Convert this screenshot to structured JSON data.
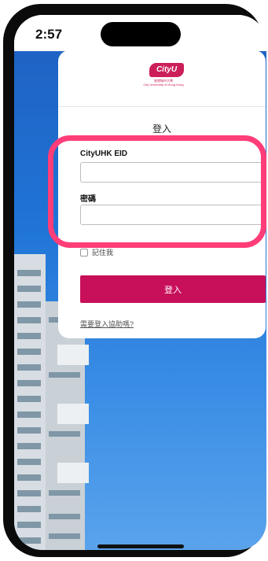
{
  "status": {
    "time": "2:57"
  },
  "login": {
    "title": "登入",
    "eid_label": "CityUHK EID",
    "eid_value": "",
    "password_label": "密碼",
    "password_value": "",
    "remember_label": "記住我",
    "submit_label": "登入",
    "help_link": "需要登入協助嗎?"
  },
  "logo": {
    "mark": "CityU",
    "name_zh": "香港城市大學",
    "name_en": "City University of Hong Kong"
  },
  "colors": {
    "brand": "#c8105a",
    "highlight": "#ff3d78",
    "sky": "#1f74d6"
  }
}
